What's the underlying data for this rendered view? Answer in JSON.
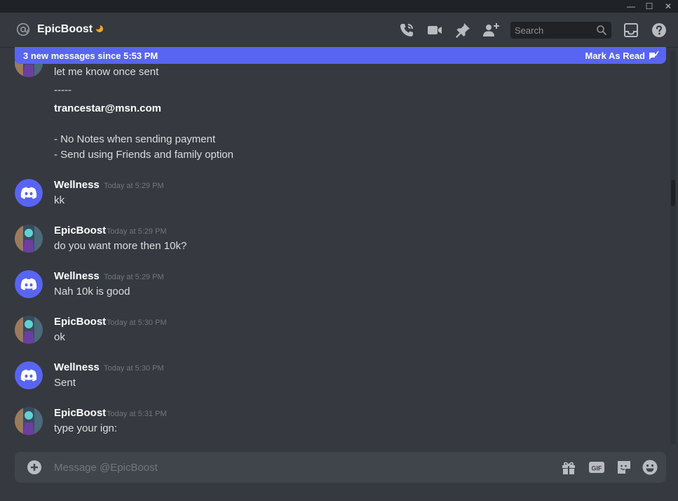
{
  "window": {
    "minimize": "—",
    "maximize": "☐",
    "close": "✕"
  },
  "header": {
    "channel_name": "EpicBoost"
  },
  "search": {
    "placeholder": "Search"
  },
  "banner": {
    "text": "3 new messages since 5:53 PM",
    "action": "Mark As Read"
  },
  "continued": {
    "line1": "let me know once sent",
    "line2": "-----",
    "email": "trancestar@msn.com",
    "line3": "- No Notes when sending payment",
    "line4": "- Send using Friends and family option"
  },
  "messages": [
    {
      "author": "Wellness",
      "timestamp": "Today at 5:29 PM",
      "text": "kk"
    },
    {
      "author": "EpicBoost",
      "timestamp": "Today at 5:29 PM",
      "text": "do you want more then 10k?"
    },
    {
      "author": "Wellness",
      "timestamp": "Today at 5:29 PM",
      "text": "Nah 10k is good"
    },
    {
      "author": "EpicBoost",
      "timestamp": "Today at 5:30 PM",
      "text": "ok"
    },
    {
      "author": "Wellness",
      "timestamp": "Today at 5:30 PM",
      "text": "Sent"
    },
    {
      "author": "EpicBoost",
      "timestamp": "Today at 5:31 PM",
      "text": "type your ign:"
    }
  ],
  "composer": {
    "placeholder": "Message @EpicBoost"
  },
  "colors": {
    "blurple": "#5865f2",
    "background": "#36393f",
    "input": "#40444b",
    "idle": "#faa81a"
  }
}
